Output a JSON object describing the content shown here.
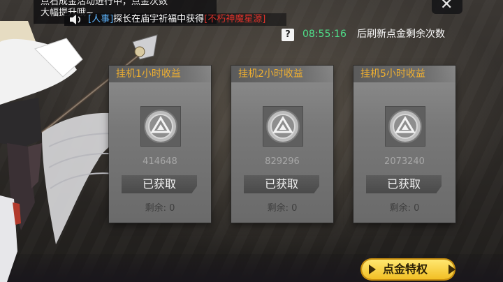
{
  "notice": {
    "line1": "点石成金活动进行中，点金次数",
    "line2": "大幅提升哦~"
  },
  "broadcast": {
    "name": "[人事]",
    "text": "探长在庙宇祈福中获得",
    "item": "[不朽神魔星源]"
  },
  "timer": {
    "help_label": "?",
    "time": "08:55:16",
    "text": "后刷新点金剩余次数"
  },
  "cards": [
    {
      "title": "挂机1小时收益",
      "amount": "414648",
      "button": "已获取",
      "remaining": "剩余: 0"
    },
    {
      "title": "挂机2小时收益",
      "amount": "829296",
      "button": "已获取",
      "remaining": "剩余: 0"
    },
    {
      "title": "挂机5小时收益",
      "amount": "2073240",
      "button": "已获取",
      "remaining": "剩余: 0"
    }
  ],
  "special_button": {
    "label": "点金特权"
  },
  "icons": {
    "coin": "silver-triangle-coin-icon",
    "speaker": "speaker-icon",
    "help": "help-icon",
    "close": "close-icon"
  },
  "colors": {
    "title_orange": "#f0b030",
    "timer_green": "#4fe08a",
    "broadcast_blue": "#5fb6ff",
    "broadcast_red": "#e0322b",
    "gold_button": "#f2bf25"
  }
}
